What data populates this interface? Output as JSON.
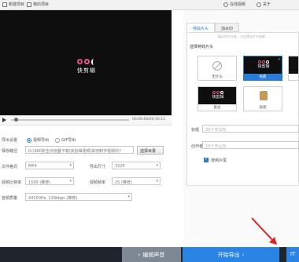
{
  "topbar": {
    "new_project": "新建项目",
    "my_projects": "我的项目",
    "help": "在线视频",
    "info": "关于"
  },
  "player": {
    "brand": "快剪辑",
    "time": "00:00:00/00:16:12"
  },
  "export": {
    "export_settings": "导出设置",
    "video_export": "视频导出",
    "gif_export": "GIF导出",
    "save_path_label": "保存路径",
    "save_path_value": "D:\\360安全浏览器下载\\快剪辑视频\\如何制作视频的?",
    "browse": "选择目录",
    "format_label": "文件格式",
    "format_value": "MP4",
    "size_label": "导出尺寸",
    "size_value": "720P",
    "bitrate_label": "视频比特率",
    "bitrate_value": "1500 (推荐)",
    "fps_label": "视频帧率",
    "fps_value": "25 (推荐)",
    "audio_label": "音频质量",
    "audio_value": "44100Hz, 128kbps (推荐)"
  },
  "right": {
    "tab_title": "特效片头",
    "tab_watermark": "加水印",
    "hint": "展示在片头处，点击预览片头效果",
    "section": "选择特效片头",
    "thumbs": [
      "无片头",
      "经典",
      "复古",
      "质感"
    ],
    "title_label": "标题",
    "title_placeholder": "20个字以内",
    "author_label": "创作者",
    "author_placeholder": "10个字以内",
    "use_intro": "使用片尾"
  },
  "bottom": {
    "edit_sound": "编辑声音",
    "start_export": "开始导出",
    "side": "IT"
  },
  "colors": {
    "accent": "#2a84e3",
    "dark": "#0e0e0e",
    "bottom": "#20242c"
  }
}
